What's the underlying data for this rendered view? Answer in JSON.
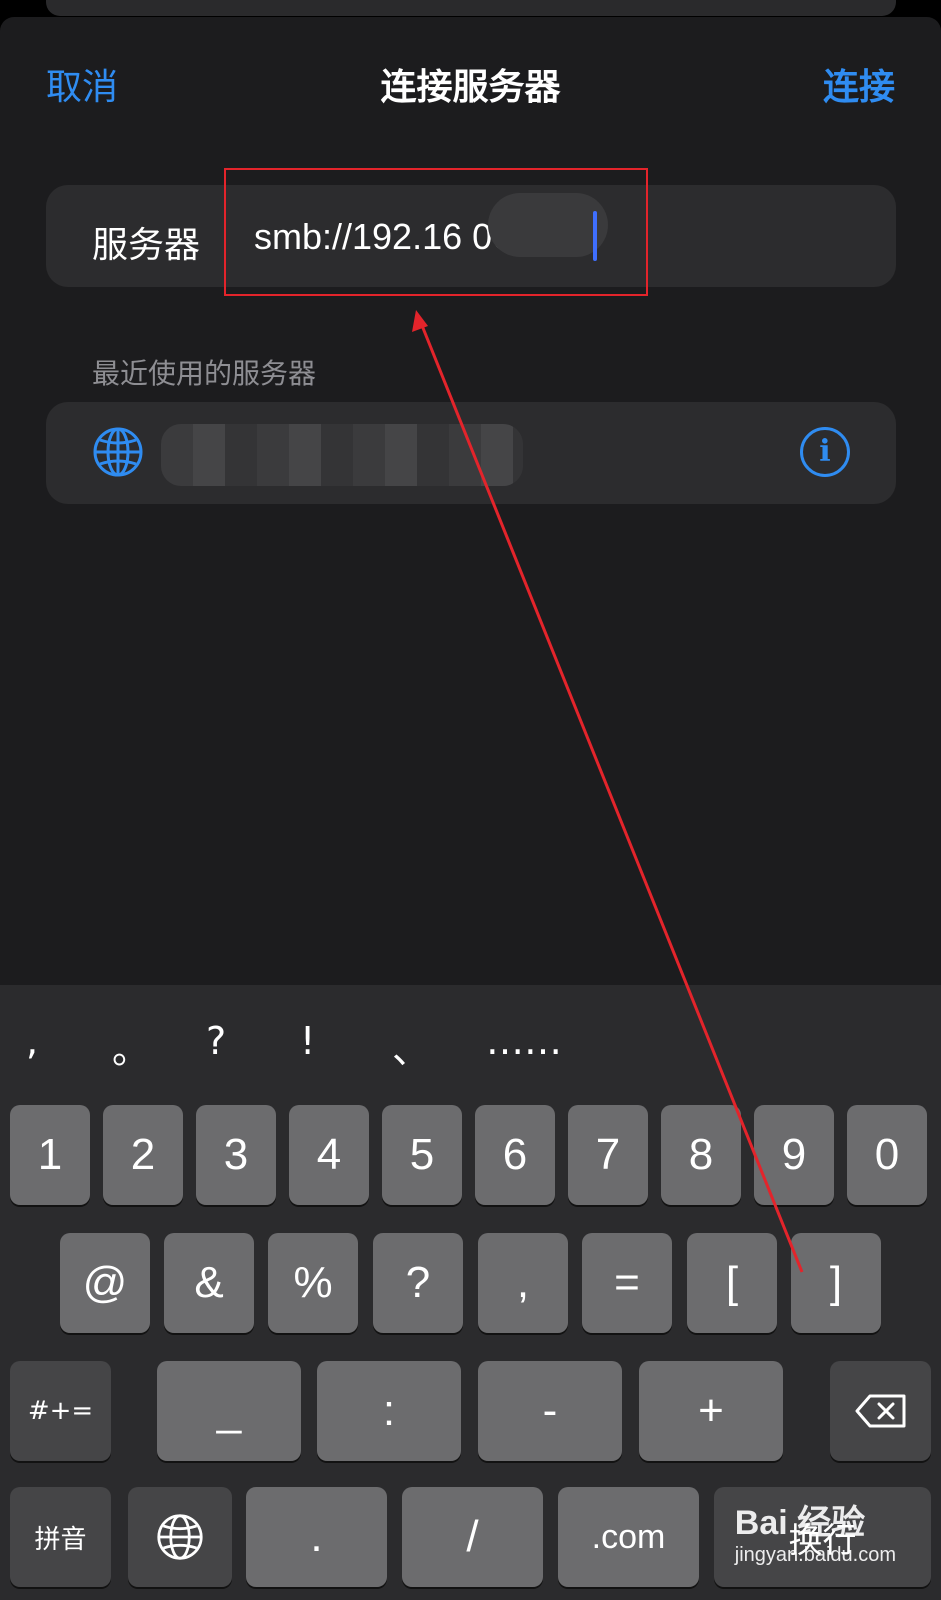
{
  "nav": {
    "cancel_label": "取消",
    "title": "连接服务器",
    "connect_label": "连接"
  },
  "server": {
    "label": "服务器",
    "value": "smb://192.16   06"
  },
  "recent": {
    "section_label": "最近使用的服务器",
    "globe_icon": "globe-icon",
    "info_icon": "info-icon",
    "info_glyph": "i"
  },
  "keyboard": {
    "suggestions": [
      ",",
      "。",
      "?",
      "!",
      "、",
      "……"
    ],
    "row1": [
      "1",
      "2",
      "3",
      "4",
      "5",
      "6",
      "7",
      "8",
      "9",
      "0"
    ],
    "row2": [
      "@",
      "&",
      "%",
      "?",
      ",",
      "=",
      "[",
      "]"
    ],
    "row3": {
      "shift_label": "#+=",
      "keys": [
        "_",
        ":",
        "-",
        "+"
      ],
      "delete_icon": "backspace-icon"
    },
    "row4": {
      "pinyin_label": "拼音",
      "globe_icon": "globe-icon",
      "keys": [
        ".",
        "/",
        ".com"
      ],
      "return_label": "换行"
    }
  },
  "watermark": {
    "brand": "Bai 经验",
    "sub": "jingyan.baidu.com"
  },
  "colors": {
    "accent": "#2f8cf1",
    "annotation_red": "#e3242b",
    "caret": "#3f6fff"
  }
}
